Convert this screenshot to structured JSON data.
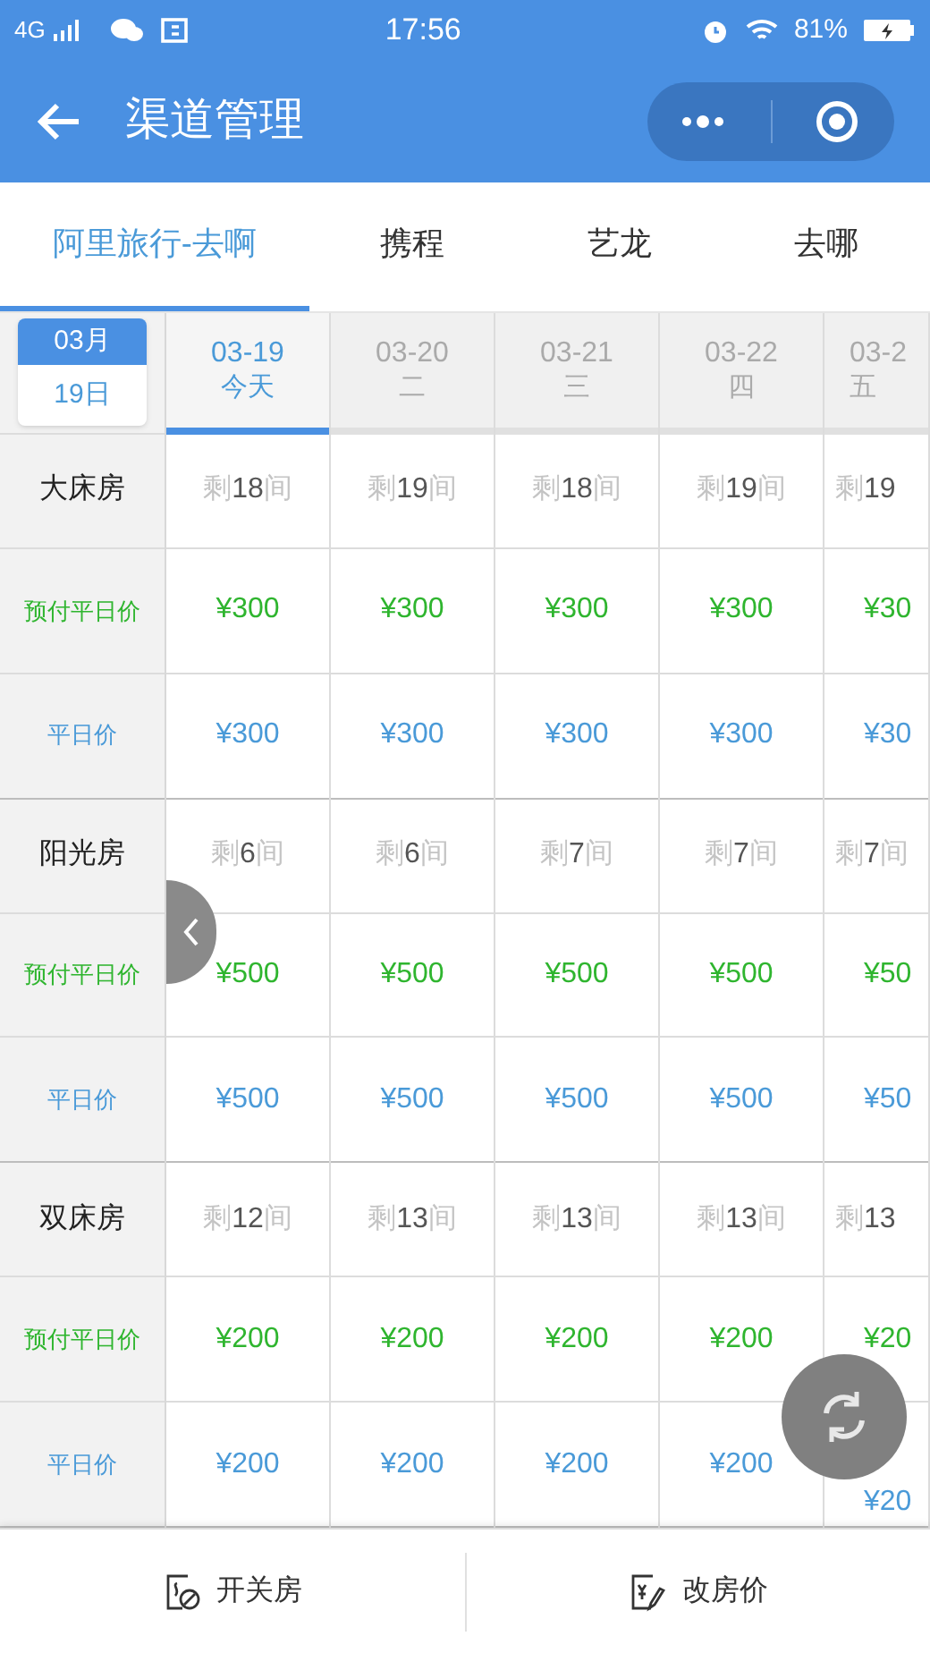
{
  "status_bar": {
    "network": "4G",
    "time": "17:56",
    "battery": "81%"
  },
  "header": {
    "title": "渠道管理"
  },
  "tabs": [
    {
      "label": "阿里旅行-去啊",
      "selected": true
    },
    {
      "label": "携程",
      "selected": false
    },
    {
      "label": "艺龙",
      "selected": false
    },
    {
      "label": "去哪",
      "selected": false
    }
  ],
  "calendar": {
    "month": "03月",
    "day": "19日"
  },
  "dates": [
    {
      "date": "03-19",
      "weekday": "今天",
      "selected": true
    },
    {
      "date": "03-20",
      "weekday": "二",
      "selected": false
    },
    {
      "date": "03-21",
      "weekday": "三",
      "selected": false
    },
    {
      "date": "03-22",
      "weekday": "四",
      "selected": false
    },
    {
      "date": "03-2",
      "weekday": "五",
      "selected": false
    }
  ],
  "rooms": [
    {
      "name": "大床房",
      "availability": [
        "剩**18**间",
        "剩**19**间",
        "剩**18**间",
        "剩**19**间",
        "剩**19**"
      ],
      "prices": [
        {
          "label": "预付平日价",
          "kind": "prepay",
          "values": [
            "¥300",
            "¥300",
            "¥300",
            "¥300",
            "¥30"
          ]
        },
        {
          "label": "平日价",
          "kind": "weekday",
          "values": [
            "¥300",
            "¥300",
            "¥300",
            "¥300",
            "¥30"
          ]
        }
      ]
    },
    {
      "name": "阳光房",
      "availability": [
        "剩**6**间",
        "剩**6**间",
        "剩**7**间",
        "剩**7**间",
        "剩**7**间"
      ],
      "prices": [
        {
          "label": "预付平日价",
          "kind": "prepay",
          "values": [
            "¥500",
            "¥500",
            "¥500",
            "¥500",
            "¥50"
          ]
        },
        {
          "label": "平日价",
          "kind": "weekday",
          "values": [
            "¥500",
            "¥500",
            "¥500",
            "¥500",
            "¥50"
          ]
        }
      ]
    },
    {
      "name": "双床房",
      "availability": [
        "剩**12**间",
        "剩**13**间",
        "剩**13**间",
        "剩**13**间",
        "剩**13**"
      ],
      "prices": [
        {
          "label": "预付平日价",
          "kind": "prepay",
          "values": [
            "¥200",
            "¥200",
            "¥200",
            "¥200",
            "¥20"
          ]
        },
        {
          "label": "平日价",
          "kind": "weekday",
          "values": [
            "¥200",
            "¥200",
            "¥200",
            "¥200",
            "¥20"
          ]
        }
      ]
    }
  ],
  "bottom_bar": [
    {
      "label": "开关房",
      "kind": "toggle"
    },
    {
      "label": "改房价",
      "kind": "price"
    }
  ]
}
